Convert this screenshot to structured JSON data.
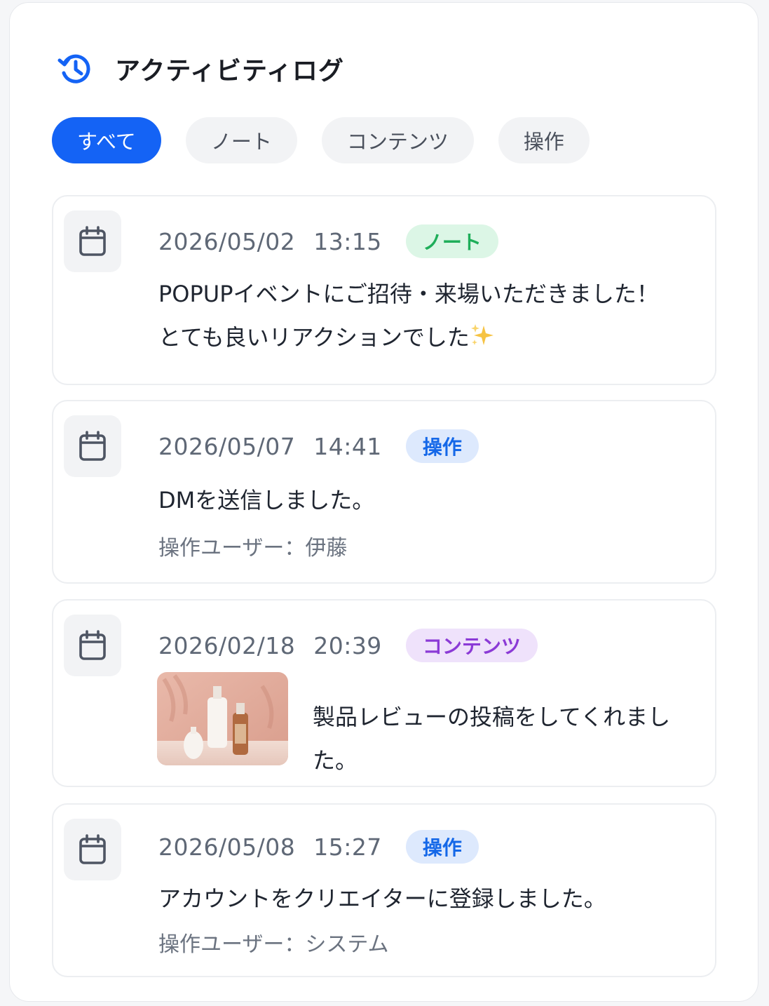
{
  "header": {
    "title": "アクティビティログ",
    "icon": "history-icon",
    "accent": "#1463f5"
  },
  "tabs": [
    {
      "label": "すべて",
      "active": true
    },
    {
      "label": "ノート",
      "active": false
    },
    {
      "label": "コンテンツ",
      "active": false
    },
    {
      "label": "操作",
      "active": false
    }
  ],
  "entries": [
    {
      "date": "2026/05/02",
      "time": "13:15",
      "tag": "ノート",
      "tag_color": "#1fae5a",
      "message_line1": "POPUPイベントにご招待・来場いただきました！",
      "message_line2": "とても良いリアクションでした",
      "emoji": "sparkles-icon"
    },
    {
      "date": "2026/05/07",
      "time": "14:41",
      "tag": "操作",
      "tag_color": "#1568e8",
      "message": "DMを送信しました。",
      "operator": "操作ユーザー：伊藤"
    },
    {
      "date": "2026/02/18",
      "time": "20:39",
      "tag": "コンテンツ",
      "tag_color": "#8b3ad6",
      "message": "製品レビューの投稿をしてくれました。",
      "thumbnail": "cosmetic-bottles-photo"
    },
    {
      "date": "2026/05/08",
      "time": "15:27",
      "tag": "操作",
      "tag_color": "#1568e8",
      "message": "アカウントをクリエイターに登録しました。",
      "operator": "操作ユーザー：システム"
    }
  ]
}
